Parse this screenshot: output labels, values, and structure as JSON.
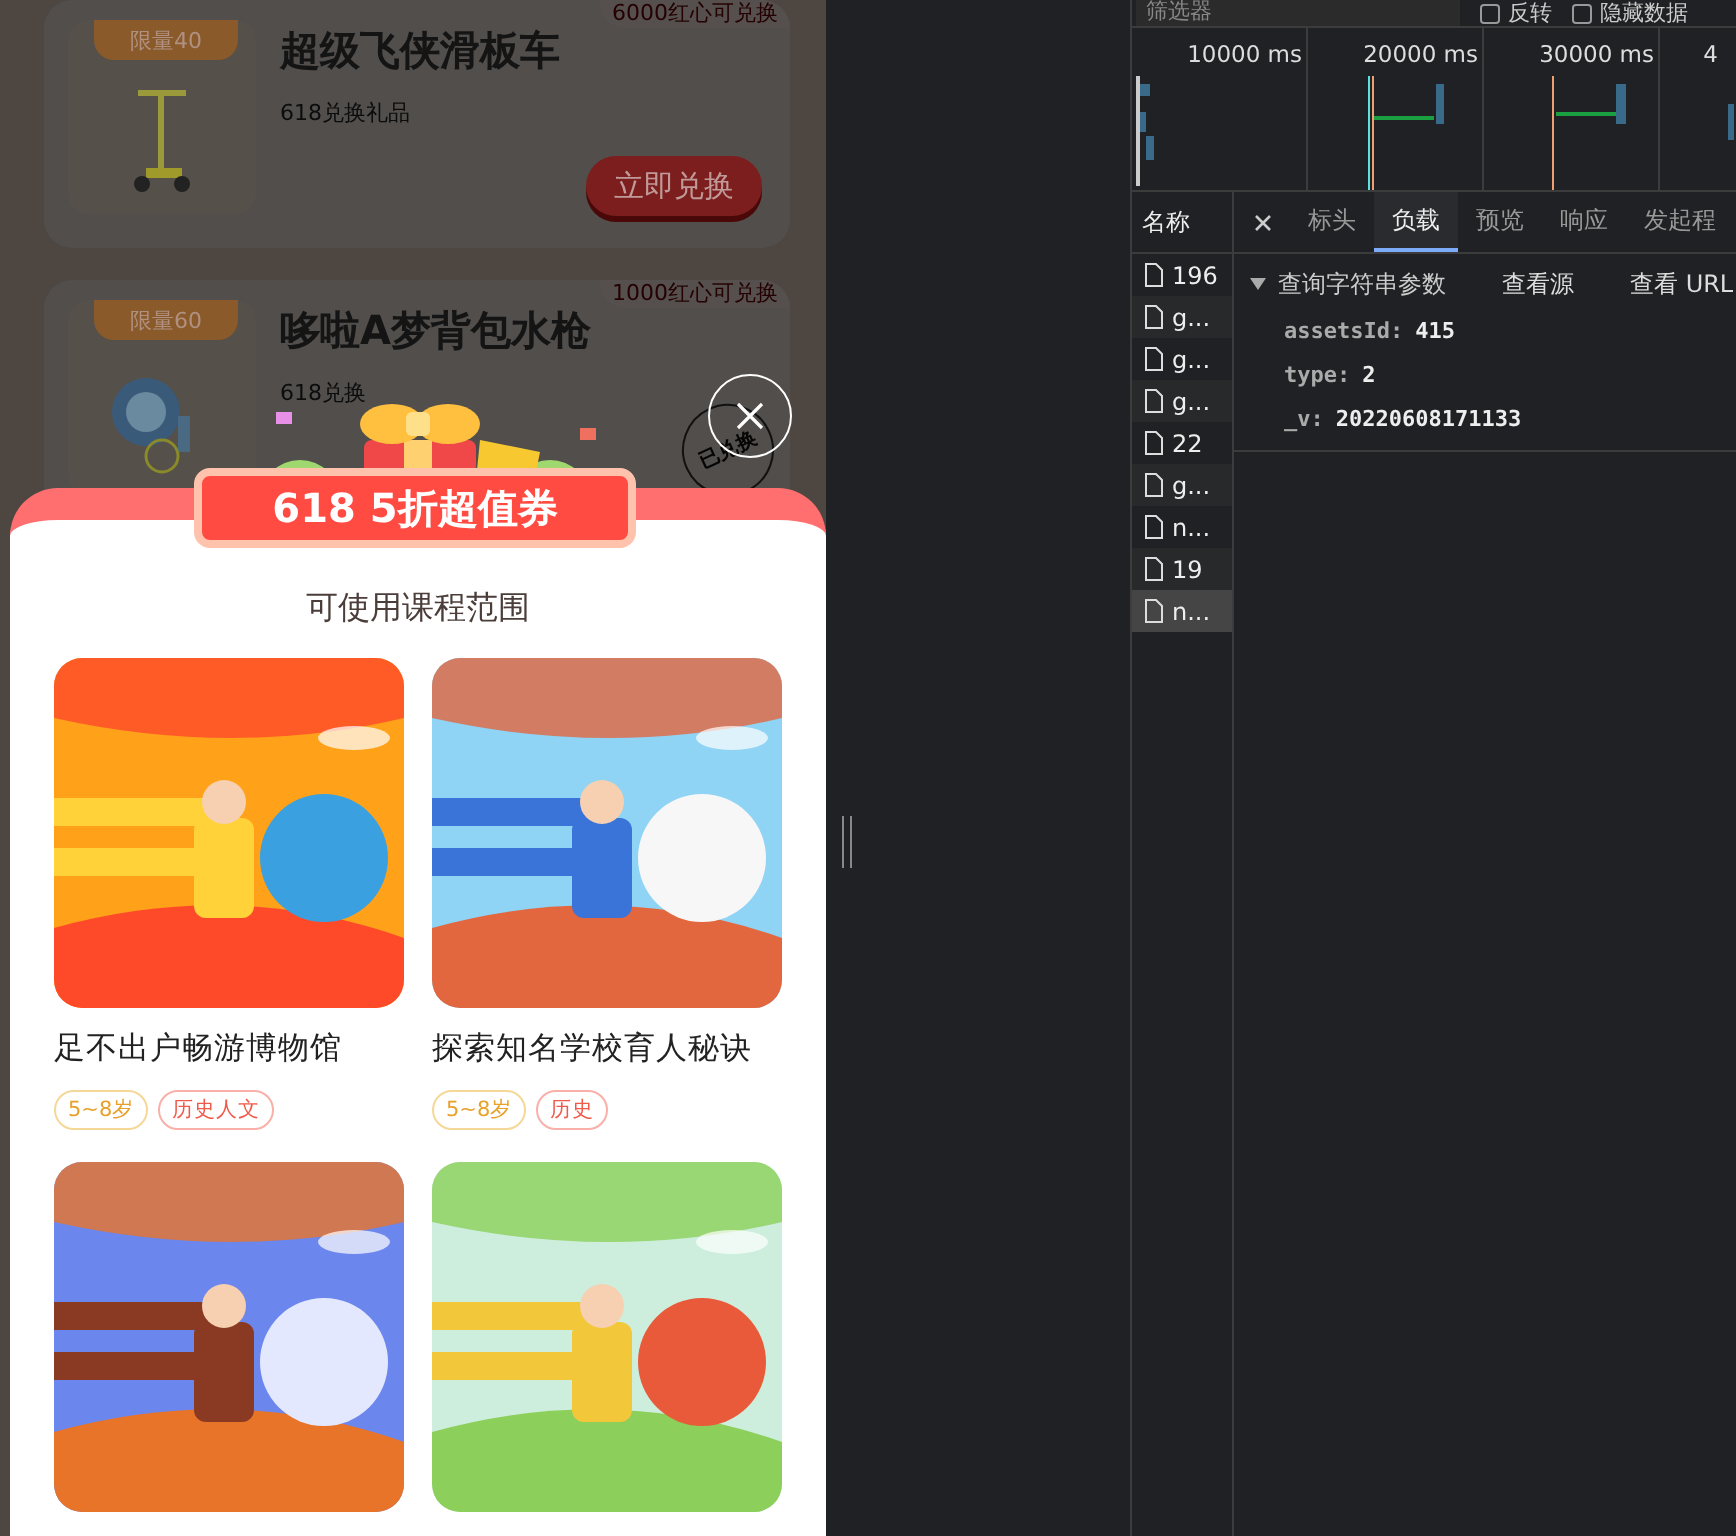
{
  "background_page": {
    "cards": [
      {
        "badge": "限量40",
        "title": "超级飞侠滑板车",
        "subtitle": "618兑换礼品",
        "price_note": "6000红心可兑换",
        "button": "立即兑换"
      },
      {
        "badge": "限量60",
        "title": "哆啦A梦背包水枪",
        "subtitle": "618兑换",
        "price_note": "1000红心可兑换",
        "stamp": "已兑换"
      }
    ]
  },
  "popup": {
    "banner": "618 5折超值券",
    "section_title": "可使用课程范围",
    "courses": [
      {
        "cover": {
          "kind": "picture"
        },
        "title": "足不出户畅游博物馆",
        "tags": [
          {
            "label": "5~8岁",
            "kind": "age"
          },
          {
            "label": "历史人文",
            "kind": "subject"
          }
        ]
      },
      {
        "cover": {
          "kind": "picture"
        },
        "title": "探索知名学校育人秘诀",
        "tags": [
          {
            "label": "5~8岁",
            "kind": "age"
          },
          {
            "label": "历史",
            "kind": "subject"
          }
        ]
      },
      {
        "cover": {
          "kind": "picture"
        }
      },
      {
        "cover": {
          "kind": "picture"
        }
      }
    ]
  },
  "devtools": {
    "filter": {
      "placeholder": "筛选器"
    },
    "checkboxes": [
      {
        "label": "反转",
        "checked": false
      },
      {
        "label": "隐藏数据",
        "checked": false
      }
    ],
    "timeline": {
      "ticks": [
        "10000 ms",
        "20000 ms",
        "30000 ms",
        "4"
      ]
    },
    "requests": {
      "header": "名称",
      "items": [
        {
          "name": "196",
          "selected": false
        },
        {
          "name": "g...",
          "selected": false
        },
        {
          "name": "g...",
          "selected": false
        },
        {
          "name": "g...",
          "selected": false
        },
        {
          "name": "22",
          "selected": false
        },
        {
          "name": "g...",
          "selected": false
        },
        {
          "name": "n...",
          "selected": false
        },
        {
          "name": "19",
          "selected": false
        },
        {
          "name": "n...",
          "selected": true
        }
      ]
    },
    "tabs": [
      {
        "label": "标头",
        "selected": false
      },
      {
        "label": "负载",
        "selected": true
      },
      {
        "label": "预览",
        "selected": false
      },
      {
        "label": "响应",
        "selected": false
      },
      {
        "label": "发起程",
        "selected": false
      }
    ],
    "payload": {
      "section": "查询字符串参数",
      "expanded": true,
      "actions": [
        "查看源",
        "查看 URL"
      ],
      "params": [
        {
          "key": "assetsId:",
          "value": "415"
        },
        {
          "key": "type:",
          "value": "2"
        },
        {
          "key": "_v:",
          "value": "20220608171133"
        }
      ]
    }
  }
}
